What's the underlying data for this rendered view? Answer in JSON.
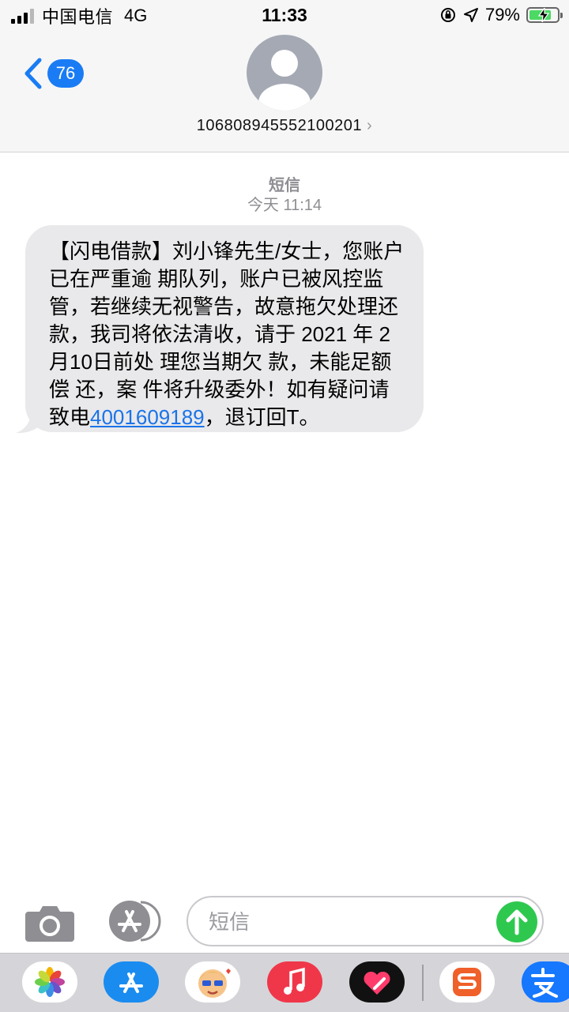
{
  "status_bar": {
    "carrier": "中国电信",
    "network": "4G",
    "time": "11:33",
    "battery_percent": "79%",
    "battery_level": 0.79,
    "charging": true
  },
  "header": {
    "back_badge_count": "76",
    "contact_number": "106808945552100201",
    "chevron": "›"
  },
  "thread": {
    "kind": "短信",
    "date": "今天 11:14"
  },
  "message": {
    "text_before_link": "【闪电借款】刘小锋先生/女士，您账户已在严重逾 期队列，账户已被风控监管，若继续无视警告，故意拖欠处理还 款，我司将依法清收，请于 2021 年 2月10日前处 理您当期欠 款，未能足额偿 还，案 件将升级委外！如有疑问请致电",
    "link_phone": "4001609189",
    "text_after_link": "，退订回T。"
  },
  "composer": {
    "placeholder": "短信"
  },
  "icons": {
    "camera": "camera-icon",
    "appstore": "app-store-icon",
    "send": "arrow-up-icon"
  },
  "app_strip": [
    {
      "name": "photos-icon",
      "color": "#ffffff"
    },
    {
      "name": "app-store-icon",
      "color": "#1a8cf0"
    },
    {
      "name": "memoji-icon",
      "color": "#ffffff"
    },
    {
      "name": "music-icon",
      "color": "#f0374a"
    },
    {
      "name": "digital-touch-icon",
      "color": "#111111"
    },
    {
      "name": "sogou-icon",
      "color": "#ffffff"
    },
    {
      "name": "alipay-icon",
      "color": "#1677ff"
    }
  ],
  "colors": {
    "accent": "#1a7cf4",
    "bubble": "#e9e9eb",
    "send": "#2fc84f"
  }
}
